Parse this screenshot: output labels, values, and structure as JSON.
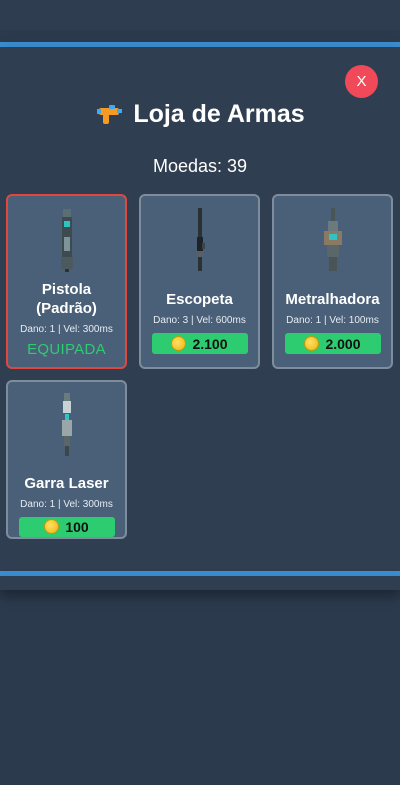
{
  "header": {
    "title": "Loja de Armas",
    "title_icon": "water-gun-icon",
    "coins_text": "Moedas: 39",
    "close_label": "X"
  },
  "weapons": [
    {
      "name_line1": "Pistola",
      "name_line2": "(Padrão)",
      "stats": "Dano: 1 | Vel: 300ms",
      "status": "EQUIPADA",
      "icon": "pistol-sprite"
    },
    {
      "name_line1": "Escopeta",
      "stats": "Dano: 3 | Vel: 600ms",
      "price": "2.100",
      "icon": "shotgun-sprite"
    },
    {
      "name_line1": "Metralhadora",
      "stats": "Dano: 1 | Vel: 100ms",
      "price": "2.000",
      "icon": "machinegun-sprite"
    },
    {
      "name_line1": "Garra Laser",
      "stats": "Dano: 1 | Vel: 300ms",
      "price": "100",
      "icon": "laser-claw-sprite"
    }
  ],
  "colors": {
    "background": "#2b3a4d",
    "accent_line": "#3b8fd4",
    "close": "#f04a5a",
    "buy": "#2ecc71",
    "equipped_border": "#e0483f"
  }
}
